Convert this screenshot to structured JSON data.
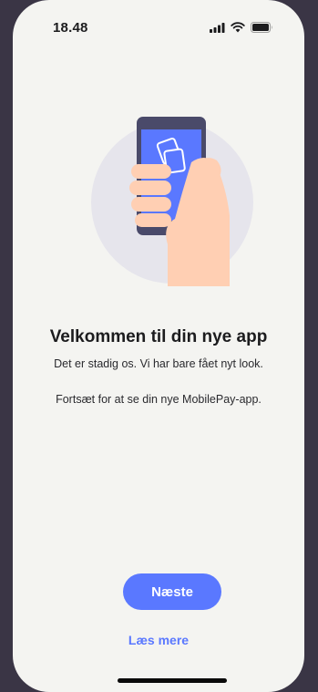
{
  "status_bar": {
    "time": "18.48",
    "icons": [
      "signal-icon",
      "wifi-icon",
      "battery-icon"
    ]
  },
  "onboarding": {
    "illustration": "phone-in-hand-icon",
    "title": "Velkommen til din nye app",
    "subtitle": "Det er stadig os. Vi har bare fået nyt look.",
    "body": "Fortsæt for at se din nye MobilePay-app."
  },
  "actions": {
    "next_label": "Næste",
    "read_more_label": "Læs mere"
  },
  "colors": {
    "accent": "#5a78ff",
    "background": "#f4f4f1",
    "phone": "#4a4a6a",
    "screen": "#5a78ff",
    "skin": "#ffcfb3"
  }
}
